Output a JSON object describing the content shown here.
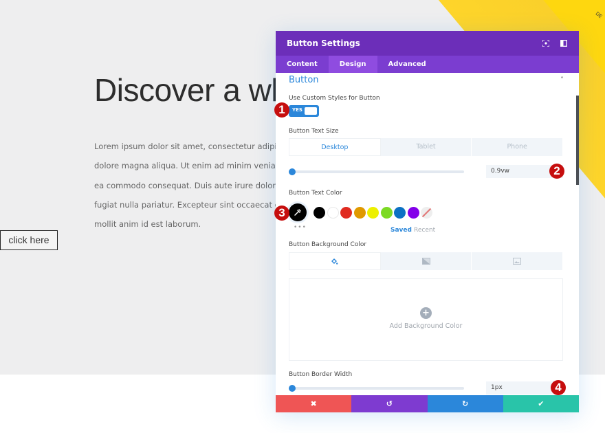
{
  "page": {
    "corner_text": "DE",
    "heading": "Discover a wh",
    "body_lines": [
      "Lorem ipsum dolor sit amet, consectetur adipiscing",
      "dolore magna aliqua. Ut enim ad minim veniam, qui",
      "ea commodo consequat. Duis aute irure dolor in rep",
      "fugiat nulla pariatur. Excepteur sint occaecat cupida",
      "mollit anim id est laborum."
    ],
    "button_label": "click here"
  },
  "modal": {
    "title": "Button Settings",
    "header_icons": [
      "focus-icon",
      "sidebar-toggle-icon"
    ],
    "tabs": [
      {
        "label": "Content",
        "active": false
      },
      {
        "label": "Design",
        "active": true
      },
      {
        "label": "Advanced",
        "active": false
      }
    ],
    "group_title": "Button",
    "use_custom_styles": {
      "label": "Use Custom Styles for Button",
      "value": "YES",
      "on": true
    },
    "text_size": {
      "label": "Button Text Size",
      "devices": [
        "Desktop",
        "Tablet",
        "Phone"
      ],
      "active_device": "Desktop",
      "value": "0.9vw",
      "slider_fraction": 0.0
    },
    "text_color": {
      "label": "Button Text Color",
      "selected": "#000000",
      "swatches": [
        "#000000",
        "#ffffff",
        "#e02b20",
        "#e09900",
        "#edf000",
        "#7cda24",
        "#0c71c3",
        "#8300e9"
      ],
      "more": "•••",
      "saved_label": "Saved",
      "recent_label": "Recent"
    },
    "background_color": {
      "label": "Button Background Color",
      "tabs": [
        "color-icon",
        "gradient-icon",
        "image-icon"
      ],
      "add_label": "Add Background Color"
    },
    "border_width": {
      "label": "Button Border Width",
      "value": "1px",
      "slider_fraction": 0.0
    },
    "footer": {
      "buttons": [
        {
          "name": "cancel",
          "glyph": "✖",
          "color": "#ef5555"
        },
        {
          "name": "undo",
          "glyph": "↺",
          "color": "#7e3bd0"
        },
        {
          "name": "redo",
          "glyph": "↻",
          "color": "#2b87da"
        },
        {
          "name": "save",
          "glyph": "✔",
          "color": "#29c4a9"
        }
      ]
    }
  },
  "markers": [
    "1",
    "2",
    "3",
    "4"
  ],
  "colors": {
    "header": "#6c2eb9",
    "tabs": "#7b3dd0",
    "accent": "#2b87da",
    "marker": "#c60e0e"
  }
}
